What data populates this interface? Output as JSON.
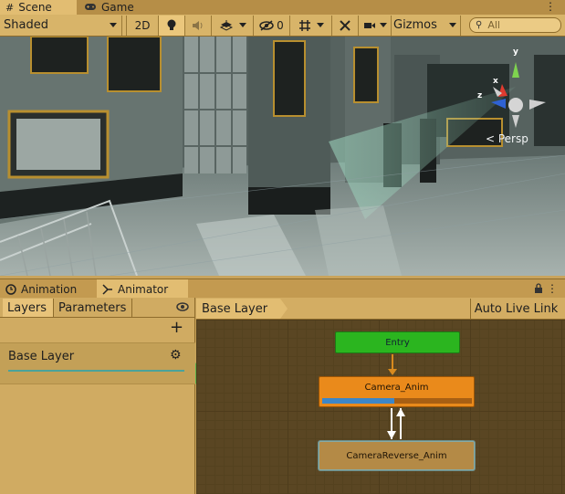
{
  "top_tabs": {
    "scene_label": "Scene",
    "game_label": "Game",
    "scene_icon": "grid-icon",
    "game_icon": "gamepad-icon"
  },
  "scene_toolbar": {
    "draw_mode": "Shaded",
    "mode_2d": "2D",
    "hidden_count": "0",
    "gizmos_label": "Gizmos",
    "search_placeholder": "All"
  },
  "viewport": {
    "projection_label": "< Persp",
    "axis_x": "x",
    "axis_y": "y",
    "axis_z": "z"
  },
  "lower_tabs": {
    "animation_label": "Animation",
    "animator_label": "Animator"
  },
  "left_panel": {
    "layers_tab": "Layers",
    "parameters_tab": "Parameters",
    "layers": [
      {
        "name": "Base Layer",
        "weight": 1.0
      }
    ]
  },
  "graph": {
    "breadcrumb": "Base Layer",
    "auto_live_link": "Auto Live Link",
    "states": {
      "entry": "Entry",
      "camera_anim": "Camera_Anim",
      "camera_reverse": "CameraReverse_Anim"
    },
    "camera_anim_progress": 0.48
  },
  "colors": {
    "editor_bg": "#c9a45c",
    "entry_state": "#2bb51f",
    "default_state": "#ea8a1b",
    "state": "#b48a46",
    "progress": "#3d86c7",
    "transition": "#ffffff"
  }
}
